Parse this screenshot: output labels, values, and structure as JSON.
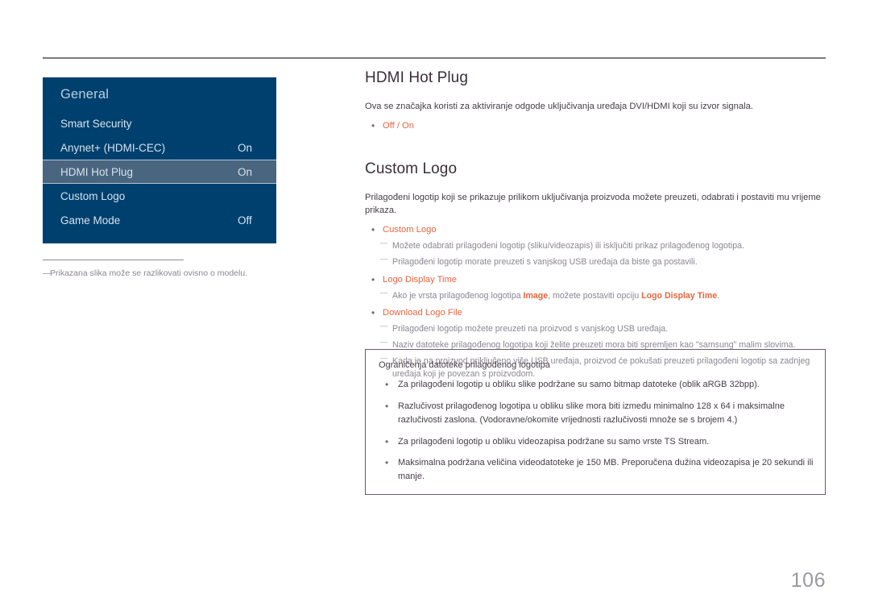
{
  "page": {
    "number": "106"
  },
  "osd_menu": {
    "title": "General",
    "rows": [
      {
        "label": "Smart Security",
        "value": "",
        "selected": false
      },
      {
        "label": "Anynet+ (HDMI-CEC)",
        "value": "On",
        "selected": false
      },
      {
        "label": "HDMI Hot Plug",
        "value": "On",
        "selected": true
      },
      {
        "label": "Custom Logo",
        "value": "",
        "selected": false
      },
      {
        "label": "Game Mode",
        "value": "Off",
        "selected": false
      }
    ]
  },
  "image_footnote": {
    "text": "Prikazana slika može se razlikovati ovisno o modelu."
  },
  "sections": {
    "hdmi_hot_plug": {
      "heading": "HDMI Hot Plug",
      "description": "Ova se značajka koristi za aktiviranje odgode uključivanja uređaja DVI/HDMI koji su izvor signala.",
      "option": "Off / On"
    },
    "custom_logo": {
      "heading": "Custom Logo",
      "description": "Prilagođeni logotip koji se prikazuje prilikom uključivanja proizvoda možete preuzeti, odabrati i postaviti mu vrijeme prikaza.",
      "items": [
        {
          "label": "Custom Logo",
          "notes": [
            "Možete odabrati prilagođeni logotip (sliku/videozapis) ili isključiti prikaz prilagođenog logotipa.",
            "Prilagođeni logotip morate preuzeti s vanjskog USB uređaja da biste ga postavili."
          ]
        },
        {
          "label": "Logo Display Time",
          "notes_rich": [
            {
              "pre": "Ako je vrsta prilagođenog logotipa ",
              "bold1": "Image",
              "mid": ", možete postaviti opciju ",
              "bold2": "Logo Display Time",
              "post": "."
            }
          ]
        },
        {
          "label": "Download Logo File",
          "notes": [
            "Prilagođeni logotip možete preuzeti na proizvod s vanjskog USB uređaja.",
            "Naziv datoteke prilagođenog logotipa koji želite preuzeti mora biti spremljen kao \"samsung\" malim slovima.",
            "Kada je na proizvod priključeno više USB uređaja, proizvod će pokušati preuzeti prilagođeni logotip sa zadnjeg uređaja koji je povezan s proizvodom."
          ]
        }
      ]
    }
  },
  "note_box": {
    "title": "Ograničenja datoteke prilagođenog logotipa",
    "items": [
      "Za prilagođeni logotip u obliku slike podržane su samo bitmap datoteke (oblik aRGB 32bpp).",
      "Razlučivost prilagođenog logotipa u obliku slike mora biti između minimalno 128 x 64 i maksimalne razlučivosti zaslona. (Vodoravne/okomite vrijednosti razlučivosti množe se s brojem 4.)",
      "Za prilagođeni logotip u obliku videozapisa podržane su samo vrste TS Stream.",
      "Maksimalna podržana veličina videodatoteke je 150 MB. Preporučena dužina videozapisa je 20 sekundi ili manje."
    ]
  },
  "colors": {
    "osd_panel": "#00406f",
    "osd_selected": "#4a657f",
    "accent_orange": "#e8643c",
    "heading": "#3a2e38",
    "box_border": "#6b5a6d"
  }
}
